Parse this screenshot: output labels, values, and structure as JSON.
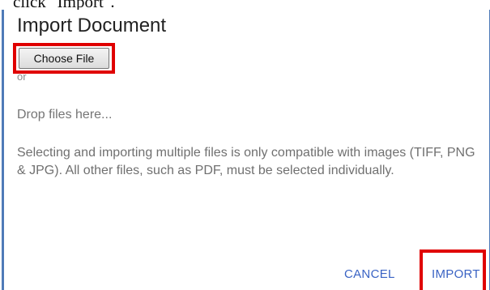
{
  "instruction": {
    "text": "click \"Import\"."
  },
  "dialog": {
    "title": "Import Document",
    "choose_file_label": "Choose File",
    "or_label": "or",
    "drop_hint": "Drop files here...",
    "info": "Selecting and importing multiple files is only compatible with images (TIFF, PNG & JPG). All other files, such as PDF, must be selected individually.",
    "cancel_label": "CANCEL",
    "import_label": "IMPORT"
  },
  "colors": {
    "highlight": "#e00000",
    "accent": "#3a63c4",
    "border": "#4f7bb8"
  }
}
